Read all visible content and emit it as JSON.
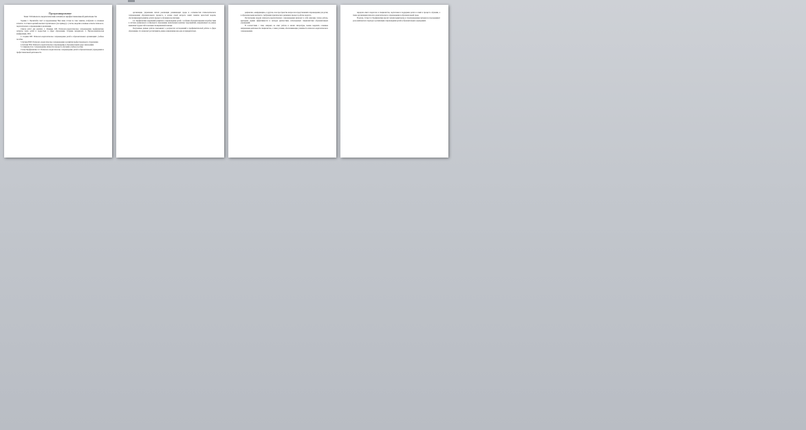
{
  "document": {
    "pages": [
      {
        "title": "Программирование",
        "heading": "Тема 3 Психолого-педагогические аспекты в профессиональной деятельности",
        "paragraphs": [
          "Задание 1. Прочитайте текст и предложенные Вам ниже статьи по теме занятия, отобразите в основных аспектах. Составьте краткий конспект прочитанного (по примеру) с учетом, выделив основные аспекты психолого-педагогического сопровождения в реализации.",
          "Список работ для анализа: 1. Лещенко О.В. Психолого-педагогическое сопровождение профилактики. Аспекты труда детей и подростков в сфере образования. Сборник материалов. 2. Научно-практическая конференция, 2016.",
          "2. Сагдина И.В. Психолого-педагогическое сопровождение детей в образовательных организациях: учебное пособие.",
          "3. Кучина Ю.В. Психолого-педагогическое сопровождение в развитии профессионального становления.",
          "4. Кобзева Н.М. Психолого-педагогическое сопровождение в образовательной среде: монография.",
          "5. Смирнова О.А. Сопровождение личности в процессе обучения: учебное пособие.",
          "Статья Профилактика 2.2. Психолого-педагогическое сопровождение детей в образовательных учреждениях и профессиональной деятельности."
        ]
      },
      {
        "paragraphs": [
          "организации, управления любой реализации развивающей среды и особенностей психологического сопровождения образовательного процесса, в основе своей которого лежит понятие целостной модели, обеспечивающей развитие детей в процессе обучения и воспитания.",
          "2.2. Профилактика нарушений развития и сопровождение детей с особыми образовательными потребностями в системе дошкольного и школьного образования, включающая комплекс мероприятий, направленных на раннее выявление трудностей и оказание своевременной помощи.",
          "Полученные данные работы показывают о результатах исследований и профилактической работы в сфере образования, что позволяет рассматривать данное направление как одно из приоритетных."
        ]
      },
      {
        "paragraphs": [
          "рефлексию, «информацию», в другом, и не пространство вопросов и представлений сопровождения для детей, в образовательном контексте, требующих практического решения в процессе работы педагога.",
          "Рассмотрение модели психолого-педагогического сопровождения включает в себя описание этапов работы, критериев оценки эффективности и методов диагностики, используемых специалистами образовательных учреждений.",
          "В соответствии с этим, опираясь на опыт работы и анализ литературы, можно выделить основные направления деятельности специалистов, а также условия, обеспечивающие успешность психолого-педагогического сопровождения."
        ]
      },
      {
        "paragraphs": [
          "передачи опыта педагогов и специалистов, подготовки и поддержки детей и семей в процессе обучения, а также организации психолого-педагогического сопровождения в образовательной среде.",
          "В целом, статья 2.2. Профилактика вносит значительный вклад в структурирование материала и подчеркивает роль комплексного подхода к организации сопровождения детей в образовательных учреждениях."
        ]
      }
    ]
  }
}
